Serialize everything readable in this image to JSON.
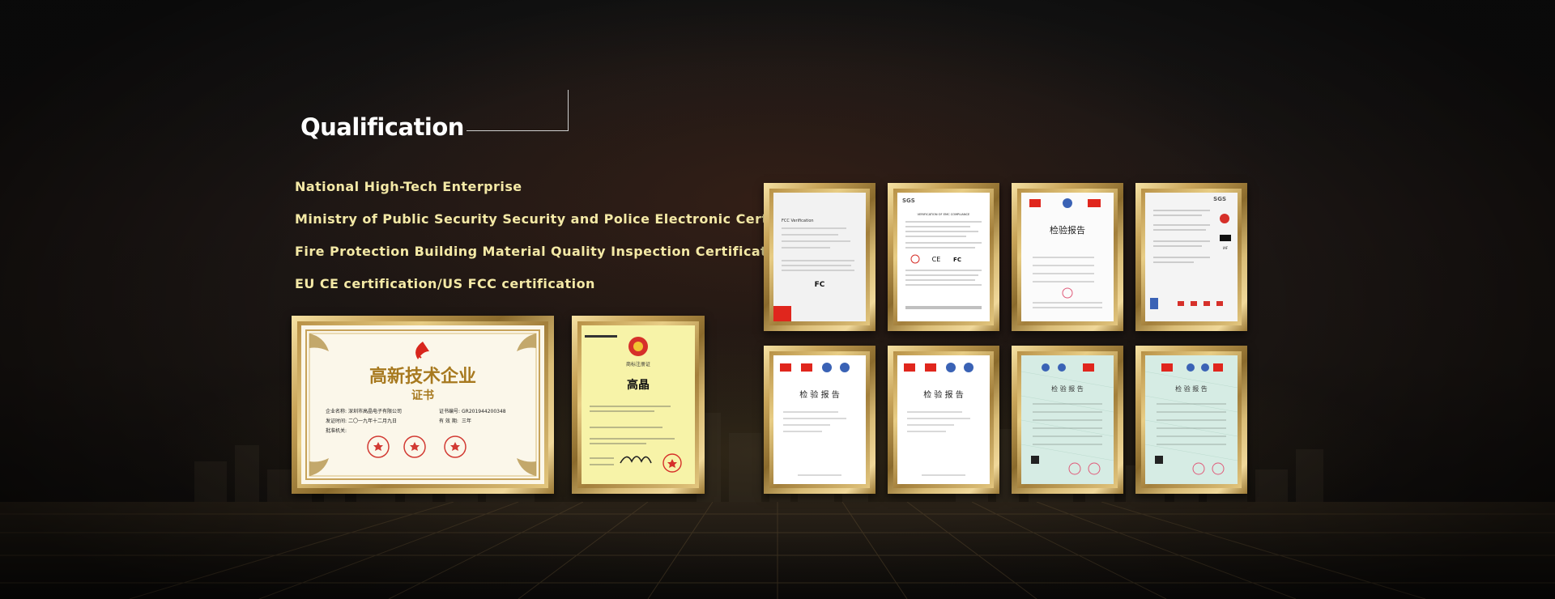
{
  "section": {
    "title": "Qualification",
    "items": [
      "National High-Tech Enterprise",
      "Ministry of Public Security Security and Police Electronic Certification",
      "Fire Protection Building Material Quality Inspection Certification",
      "EU CE certification/US FCC certification"
    ]
  },
  "colors": {
    "title": "#ffffff",
    "item_text": "#f4e9a6",
    "frame_gold": "#c9a55a",
    "background": "#1a1512"
  },
  "certificates": {
    "high_tech": {
      "title": "高新技术企业",
      "subtitle": "证书",
      "company_label": "企业名称:",
      "company": "深圳市高晶电子有限公司",
      "cert_no_label": "证书编号:",
      "cert_no": "GR201944200348",
      "date_label": "发证时间:",
      "date": "二〇一九年十二月九日",
      "valid_label": "有 效 期:",
      "valid": "三年",
      "authority_label": "批准机关:"
    },
    "trademark": {
      "header": "商标注册证",
      "brand": "高晶"
    },
    "fcc": {
      "heading": "FCC Verification",
      "mark": "FC"
    },
    "sgs_emc": {
      "brand": "SGS",
      "heading": "VERIFICATION OF EMC COMPLIANCE",
      "marks": [
        "CE",
        "FC"
      ]
    },
    "inspection_report": {
      "title": "检验报告",
      "alt_title": "检 验 报 告"
    },
    "iso": {
      "brand": "SGS",
      "badge": "IAF"
    }
  }
}
